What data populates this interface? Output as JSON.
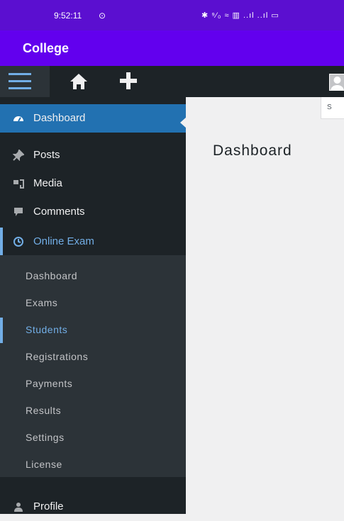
{
  "status_bar": {
    "time": "9:52:11",
    "time_icon": "⊙",
    "right_icons": "✱ ⁹⁄₀ ≈ ▥ ..ıl ..ıl ▭"
  },
  "app_bar": {
    "title": "College"
  },
  "admin_bar": {
    "icons": [
      "menu-icon",
      "home-icon",
      "plus-icon",
      "avatar"
    ]
  },
  "sidebar": {
    "items": [
      {
        "label": "Dashboard",
        "icon": "dashboard-icon"
      },
      {
        "label": "Posts",
        "icon": "pin-icon"
      },
      {
        "label": "Media",
        "icon": "media-icon"
      },
      {
        "label": "Comments",
        "icon": "comment-icon"
      },
      {
        "label": "Online Exam",
        "icon": "clock-icon"
      },
      {
        "label": "Profile",
        "icon": "user-icon"
      }
    ],
    "submenu": [
      {
        "label": "Dashboard"
      },
      {
        "label": "Exams"
      },
      {
        "label": "Students"
      },
      {
        "label": "Registrations"
      },
      {
        "label": "Payments"
      },
      {
        "label": "Results"
      },
      {
        "label": "Settings"
      },
      {
        "label": "License"
      }
    ]
  },
  "content": {
    "title": "Dashboard",
    "screen_options": "S"
  },
  "colors": {
    "status_bar": "#5b0fd0",
    "app_bar": "#6200ee",
    "admin_bar": "#1d2327",
    "active": "#2271b1",
    "accent": "#72aee6"
  }
}
